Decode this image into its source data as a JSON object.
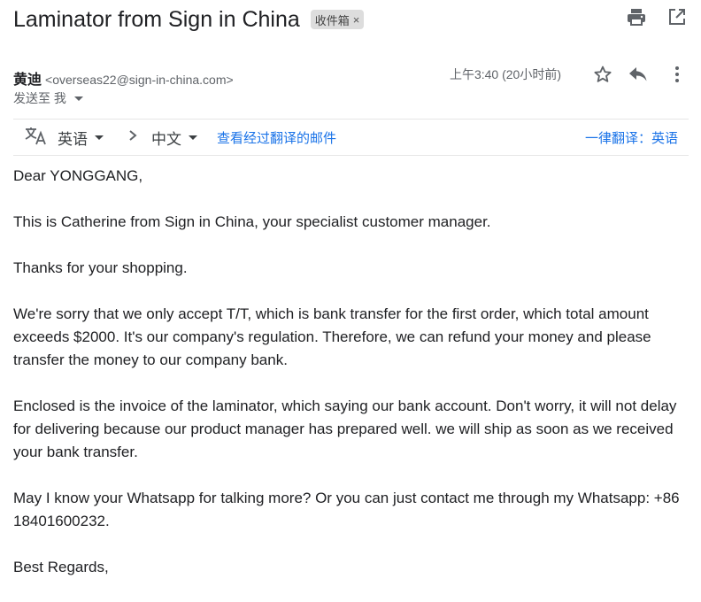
{
  "email": {
    "subject": "Laminator from Sign in China",
    "label_chip": "收件箱",
    "label_chip_close": "×",
    "sender_name": "黄迪",
    "sender_email": "<overseas22@sign-in-china.com>",
    "recipient": "发送至 我",
    "timestamp": "上午3:40 (20小时前)"
  },
  "icons": {
    "print": "print-icon",
    "open_new_window": "open-in-new-window-icon",
    "star": "star-icon",
    "reply": "reply-icon",
    "more": "more-vertical-icon",
    "translate": "translate-icon",
    "chevron_right": "chevron-right-icon"
  },
  "translate_bar": {
    "source_lang": "英语",
    "target_lang": "中文",
    "view_translation": "查看经过翻译的邮件",
    "always_translate": "一律翻译：英语"
  },
  "body": {
    "greeting": "Dear YONGGANG,",
    "p1": "This is Catherine from Sign in China, your specialist customer manager.",
    "p2": "Thanks for your shopping.",
    "p3": "We're sorry that we only accept T/T, which is bank transfer for the first order, which total amount exceeds $2000. It's our company's regulation. Therefore, we can refund your money and please transfer the money to our company bank.",
    "p4": "Enclosed is the invoice of the laminator, which saying our bank account. Don't worry, it will not delay for delivering because our product manager has prepared well. we will ship as soon as we received your bank transfer.",
    "p5": "May I know your Whatsapp for talking more? Or you can just contact me through my Whatsapp: +86 18401600232.",
    "closing": "Best Regards,"
  },
  "colors": {
    "link": "#1a73e8",
    "chip_bg": "#dddddd",
    "icon": "#5f6368"
  }
}
